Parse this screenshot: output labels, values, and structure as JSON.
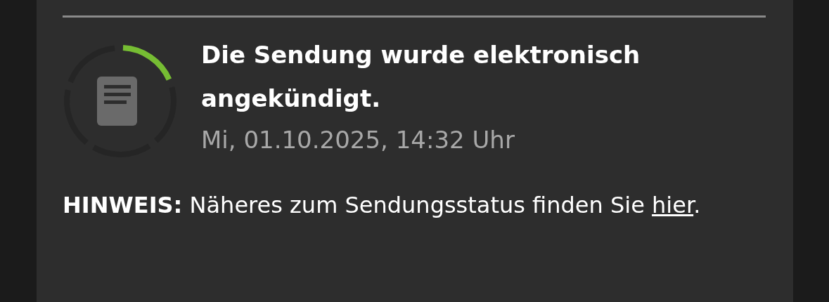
{
  "status": {
    "title": "Die Sendung wurde elektronisch angekündigt.",
    "timestamp": "Mi, 01.10.2025, 14:32 Uhr"
  },
  "hint": {
    "text": "**HINWEIS:** Näheres zum Sendungsstatus finden Sie",
    "link": "hier",
    "after": "."
  }
}
